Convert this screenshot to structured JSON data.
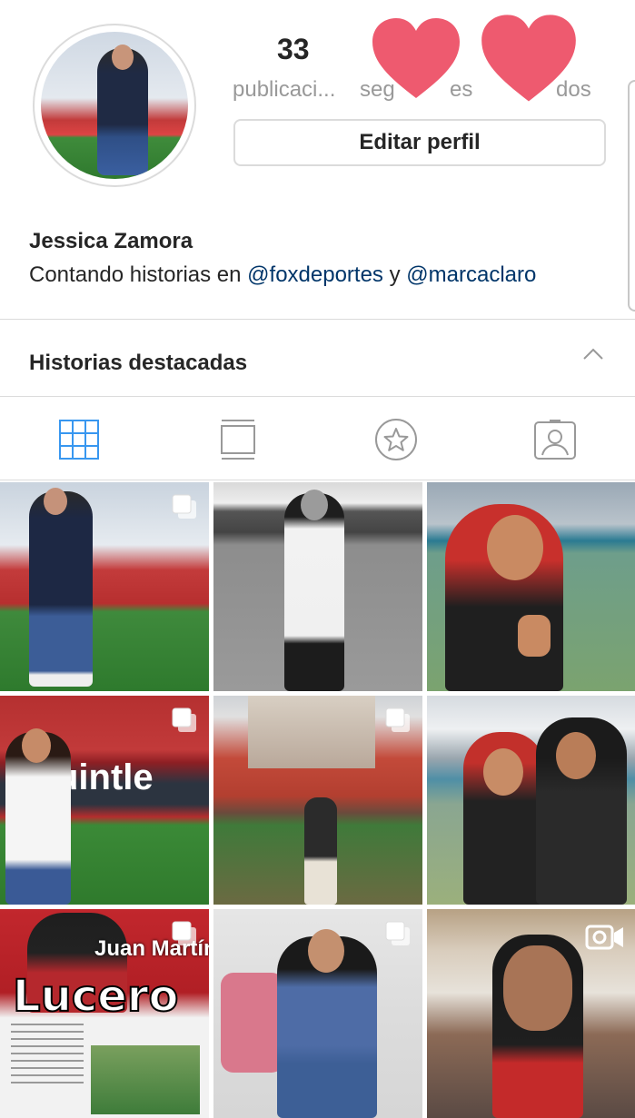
{
  "profile": {
    "posts_count": "33",
    "posts_label": "publicaci...",
    "followers_label_partial": "seg",
    "followers_label_tail": "es",
    "following_label_tail": "dos",
    "edit_button": "Editar perfil",
    "name": "Jessica Zamora",
    "bio_prefix": "Contando historias en ",
    "bio_mention_1": "@foxdeportes",
    "bio_middle": " y ",
    "bio_mention_2": "@marcaclaro"
  },
  "highlights": {
    "title": "Historias destacadas"
  },
  "tabs": [
    {
      "name": "grid-icon",
      "active": true
    },
    {
      "name": "feed-icon",
      "active": false
    },
    {
      "name": "star-icon",
      "active": false
    },
    {
      "name": "tagged-icon",
      "active": false
    }
  ],
  "grid_posts": [
    {
      "type": "carousel"
    },
    {
      "type": "photo"
    },
    {
      "type": "photo"
    },
    {
      "type": "carousel",
      "visible_text": "uintle"
    },
    {
      "type": "carousel"
    },
    {
      "type": "photo"
    },
    {
      "type": "carousel",
      "visible_text_1": "Juan Martín",
      "visible_text_2": "Lucero"
    },
    {
      "type": "carousel"
    },
    {
      "type": "video"
    }
  ],
  "colors": {
    "accent_blue": "#3897f0",
    "mention_blue": "#003569",
    "heart_pink": "#ee5a6f",
    "divider": "#dbdbdb"
  }
}
